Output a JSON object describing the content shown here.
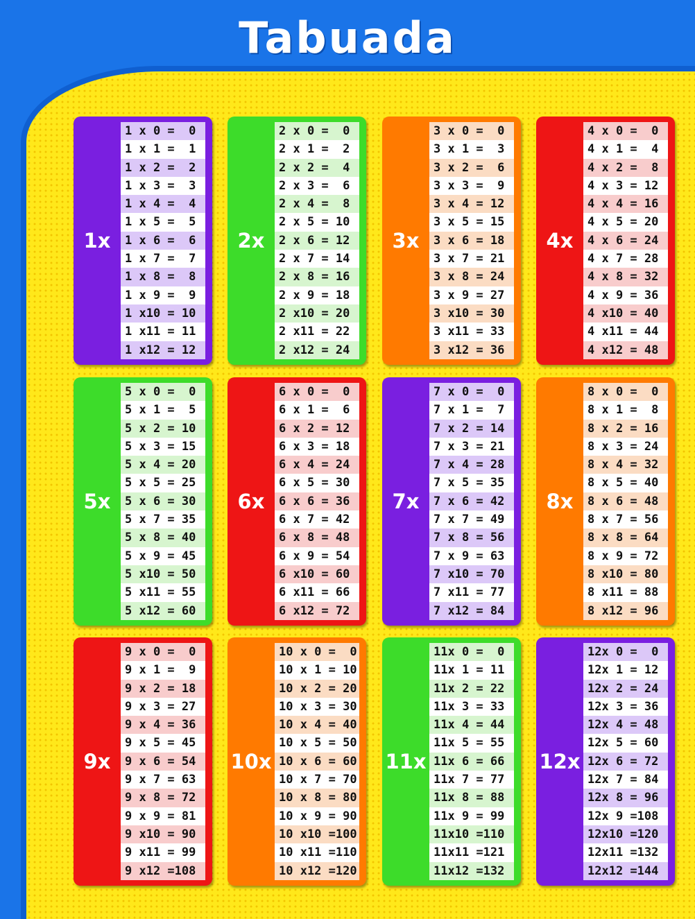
{
  "title": "Tabuada",
  "tables": [
    {
      "label": "1x",
      "color": "#7a1fe0",
      "stripe": "#dcc8f8",
      "rows": [
        "1 x 0 =  0",
        "1 x 1 =  1",
        "1 x 2 =  2",
        "1 x 3 =  3",
        "1 x 4 =  4",
        "1 x 5 =  5",
        "1 x 6 =  6",
        "1 x 7 =  7",
        "1 x 8 =  8",
        "1 x 9 =  9",
        "1 x10 = 10",
        "1 x11 = 11",
        "1 x12 = 12"
      ]
    },
    {
      "label": "2x",
      "color": "#3ddc2a",
      "stripe": "#d7f5cf",
      "rows": [
        "2 x 0 =  0",
        "2 x 1 =  2",
        "2 x 2 =  4",
        "2 x 3 =  6",
        "2 x 4 =  8",
        "2 x 5 = 10",
        "2 x 6 = 12",
        "2 x 7 = 14",
        "2 x 8 = 16",
        "2 x 9 = 18",
        "2 x10 = 20",
        "2 x11 = 22",
        "2 x12 = 24"
      ]
    },
    {
      "label": "3x",
      "color": "#ff7a00",
      "stripe": "#fbdcc3",
      "rows": [
        "3 x 0 =  0",
        "3 x 1 =  3",
        "3 x 2 =  6",
        "3 x 3 =  9",
        "3 x 4 = 12",
        "3 x 5 = 15",
        "3 x 6 = 18",
        "3 x 7 = 21",
        "3 x 8 = 24",
        "3 x 9 = 27",
        "3 x10 = 30",
        "3 x11 = 33",
        "3 x12 = 36"
      ]
    },
    {
      "label": "4x",
      "color": "#ee1515",
      "stripe": "#f8cccc",
      "rows": [
        "4 x 0 =  0",
        "4 x 1 =  4",
        "4 x 2 =  8",
        "4 x 3 = 12",
        "4 x 4 = 16",
        "4 x 5 = 20",
        "4 x 6 = 24",
        "4 x 7 = 28",
        "4 x 8 = 32",
        "4 x 9 = 36",
        "4 x10 = 40",
        "4 x11 = 44",
        "4 x12 = 48"
      ]
    },
    {
      "label": "5x",
      "color": "#3ddc2a",
      "stripe": "#d7f5cf",
      "rows": [
        "5 x 0 =  0",
        "5 x 1 =  5",
        "5 x 2 = 10",
        "5 x 3 = 15",
        "5 x 4 = 20",
        "5 x 5 = 25",
        "5 x 6 = 30",
        "5 x 7 = 35",
        "5 x 8 = 40",
        "5 x 9 = 45",
        "5 x10 = 50",
        "5 x11 = 55",
        "5 x12 = 60"
      ]
    },
    {
      "label": "6x",
      "color": "#ee1515",
      "stripe": "#f8cccc",
      "rows": [
        "6 x 0 =  0",
        "6 x 1 =  6",
        "6 x 2 = 12",
        "6 x 3 = 18",
        "6 x 4 = 24",
        "6 x 5 = 30",
        "6 x 6 = 36",
        "6 x 7 = 42",
        "6 x 8 = 48",
        "6 x 9 = 54",
        "6 x10 = 60",
        "6 x11 = 66",
        "6 x12 = 72"
      ]
    },
    {
      "label": "7x",
      "color": "#7a1fe0",
      "stripe": "#dcc8f8",
      "rows": [
        "7 x 0 =  0",
        "7 x 1 =  7",
        "7 x 2 = 14",
        "7 x 3 = 21",
        "7 x 4 = 28",
        "7 x 5 = 35",
        "7 x 6 = 42",
        "7 x 7 = 49",
        "7 x 8 = 56",
        "7 x 9 = 63",
        "7 x10 = 70",
        "7 x11 = 77",
        "7 x12 = 84"
      ]
    },
    {
      "label": "8x",
      "color": "#ff7a00",
      "stripe": "#fbdcc3",
      "rows": [
        "8 x 0 =  0",
        "8 x 1 =  8",
        "8 x 2 = 16",
        "8 x 3 = 24",
        "8 x 4 = 32",
        "8 x 5 = 40",
        "8 x 6 = 48",
        "8 x 7 = 56",
        "8 x 8 = 64",
        "8 x 9 = 72",
        "8 x10 = 80",
        "8 x11 = 88",
        "8 x12 = 96"
      ]
    },
    {
      "label": "9x",
      "color": "#ee1515",
      "stripe": "#f8cccc",
      "rows": [
        "9 x 0 =  0",
        "9 x 1 =  9",
        "9 x 2 = 18",
        "9 x 3 = 27",
        "9 x 4 = 36",
        "9 x 5 = 45",
        "9 x 6 = 54",
        "9 x 7 = 63",
        "9 x 8 = 72",
        "9 x 9 = 81",
        "9 x10 = 90",
        "9 x11 = 99",
        "9 x12 =108"
      ]
    },
    {
      "label": "10x",
      "color": "#ff7a00",
      "stripe": "#fbdcc3",
      "rows": [
        "10 x 0 =  0",
        "10 x 1 = 10",
        "10 x 2 = 20",
        "10 x 3 = 30",
        "10 x 4 = 40",
        "10 x 5 = 50",
        "10 x 6 = 60",
        "10 x 7 = 70",
        "10 x 8 = 80",
        "10 x 9 = 90",
        "10 x10 =100",
        "10 x11 =110",
        "10 x12 =120"
      ]
    },
    {
      "label": "11x",
      "color": "#3ddc2a",
      "stripe": "#d7f5cf",
      "rows": [
        "11x 0 =  0",
        "11x 1 = 11",
        "11x 2 = 22",
        "11x 3 = 33",
        "11x 4 = 44",
        "11x 5 = 55",
        "11x 6 = 66",
        "11x 7 = 77",
        "11x 8 = 88",
        "11x 9 = 99",
        "11x10 =110",
        "11x11 =121",
        "11x12 =132"
      ]
    },
    {
      "label": "12x",
      "color": "#7a1fe0",
      "stripe": "#dcc8f8",
      "rows": [
        "12x 0 =  0",
        "12x 1 = 12",
        "12x 2 = 24",
        "12x 3 = 36",
        "12x 4 = 48",
        "12x 5 = 60",
        "12x 6 = 72",
        "12x 7 = 84",
        "12x 8 = 96",
        "12x 9 =108",
        "12x10 =120",
        "12x11 =132",
        "12x12 =144"
      ]
    }
  ]
}
